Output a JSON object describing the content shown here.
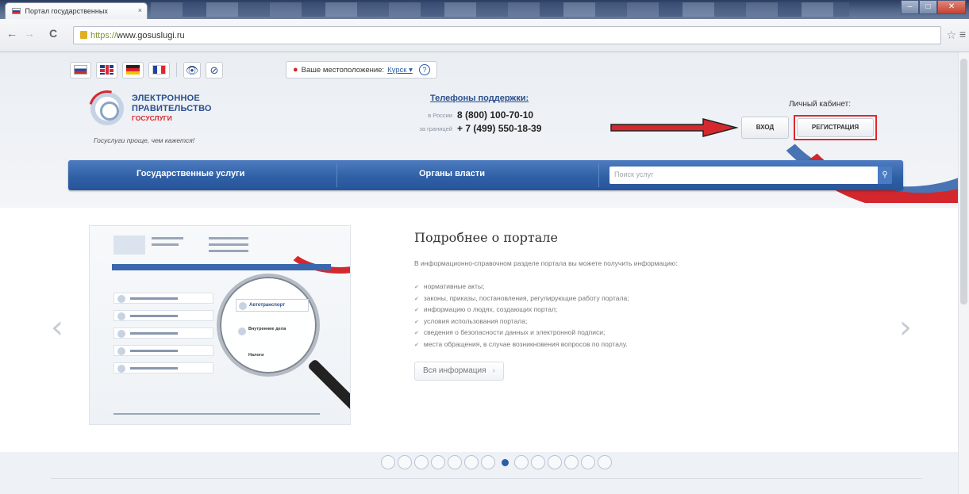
{
  "browser": {
    "tab_title": "Портал государственных",
    "tab_close": "×",
    "url_scheme": "https://",
    "url_host": "www.gosuslugi.ru",
    "back_icon": "arrow-left-icon",
    "forward_icon": "arrow-right-icon",
    "reload_icon": "reload-icon"
  },
  "header": {
    "languages": [
      "ru",
      "en",
      "de",
      "fr"
    ],
    "location_label": "Ваше местоположение:",
    "location_city": "Курск ▾",
    "help": "?",
    "logo": {
      "line1": "ЭЛЕКТРОННОЕ",
      "line2": "ПРАВИТЕЛЬСТВО",
      "line3": "ГОСУСЛУГИ",
      "slogan": "Госуслуги проще, чем кажется!"
    },
    "phones": {
      "title": "Телефоны поддержки:",
      "rows": [
        {
          "label": "в России",
          "number": "8 (800) 100-70-10"
        },
        {
          "label": "за границей",
          "number": "+ 7 (499) 550-18-39"
        }
      ]
    },
    "cabinet": {
      "title": "Личный кабинет:",
      "login": "ВХОД",
      "register": "РЕГИСТРАЦИЯ"
    }
  },
  "navbar": {
    "services": "Государственные услуги",
    "authorities": "Органы власти",
    "search_placeholder": "Поиск услуг"
  },
  "slide": {
    "title": "Подробнее о портале",
    "intro": "В информационно-справочном разделе портала вы можете получить информацию:",
    "items": [
      "нормативные акты;",
      "законы, приказы, постановления, регулирующие работу портала;",
      "информацию о людях, создающих портал;",
      "условия использования портала;",
      "сведения о безопасности данных и электронной подписи;",
      "места обращения, в случае возникновения вопросов по порталу."
    ],
    "more_button": "Вся информация",
    "lens_text": {
      "line1": "Автотранспорт",
      "line2": "Внутренние дела",
      "line3": "Налоги"
    }
  },
  "carousel": {
    "dot_count": 14,
    "active_dot": 7
  },
  "colors": {
    "brand_blue": "#2e5ea4",
    "brand_red": "#d4282e",
    "highlight_red": "#e0262e"
  }
}
